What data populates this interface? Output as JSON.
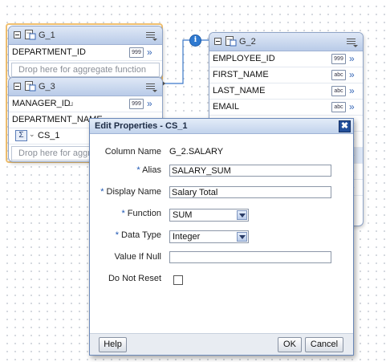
{
  "groups": {
    "g1": {
      "title": "G_1",
      "rows": [
        {
          "label": "DEPARTMENT_ID",
          "type_badge": "999"
        }
      ],
      "drop_hint": "Drop here for aggregate function"
    },
    "g3": {
      "title": "G_3",
      "rows": [
        {
          "label": "MANAGER_ID",
          "type_badge": "999"
        },
        {
          "label": "DEPARTMENT_NAME",
          "type_badge": ""
        }
      ],
      "summary_label": "CS_1",
      "drop_hint": "Drop here for aggregate function"
    },
    "g2": {
      "title": "G_2",
      "rows": [
        {
          "label": "EMPLOYEE_ID",
          "type_badge": "999"
        },
        {
          "label": "FIRST_NAME",
          "type_badge": "abc"
        },
        {
          "label": "LAST_NAME",
          "type_badge": "abc"
        },
        {
          "label": "EMAIL",
          "type_badge": "abc"
        }
      ]
    }
  },
  "link_info_badge": "i",
  "dialog": {
    "title": "Edit Properties - CS_1",
    "close_glyph": "✖",
    "fields": {
      "column_name": {
        "label": "Column Name",
        "value": "G_2.SALARY"
      },
      "alias": {
        "label": "Alias",
        "value": "SALARY_SUM",
        "required": "*"
      },
      "display_name": {
        "label": "Display Name",
        "value": "Salary Total",
        "required": "*"
      },
      "function": {
        "label": "Function",
        "value": "SUM",
        "required": "*"
      },
      "data_type": {
        "label": "Data Type",
        "value": "Integer",
        "required": "*"
      },
      "value_if_null": {
        "label": "Value If Null",
        "value": ""
      },
      "do_not_reset": {
        "label": "Do Not Reset",
        "checked": false
      }
    },
    "buttons": {
      "help": "Help",
      "ok": "OK",
      "cancel": "Cancel"
    }
  },
  "colors": {
    "accent": "#3566b6",
    "header_start": "#dfe8f6",
    "header_end": "#b9cbe8",
    "selection_border": "#f0c070"
  }
}
